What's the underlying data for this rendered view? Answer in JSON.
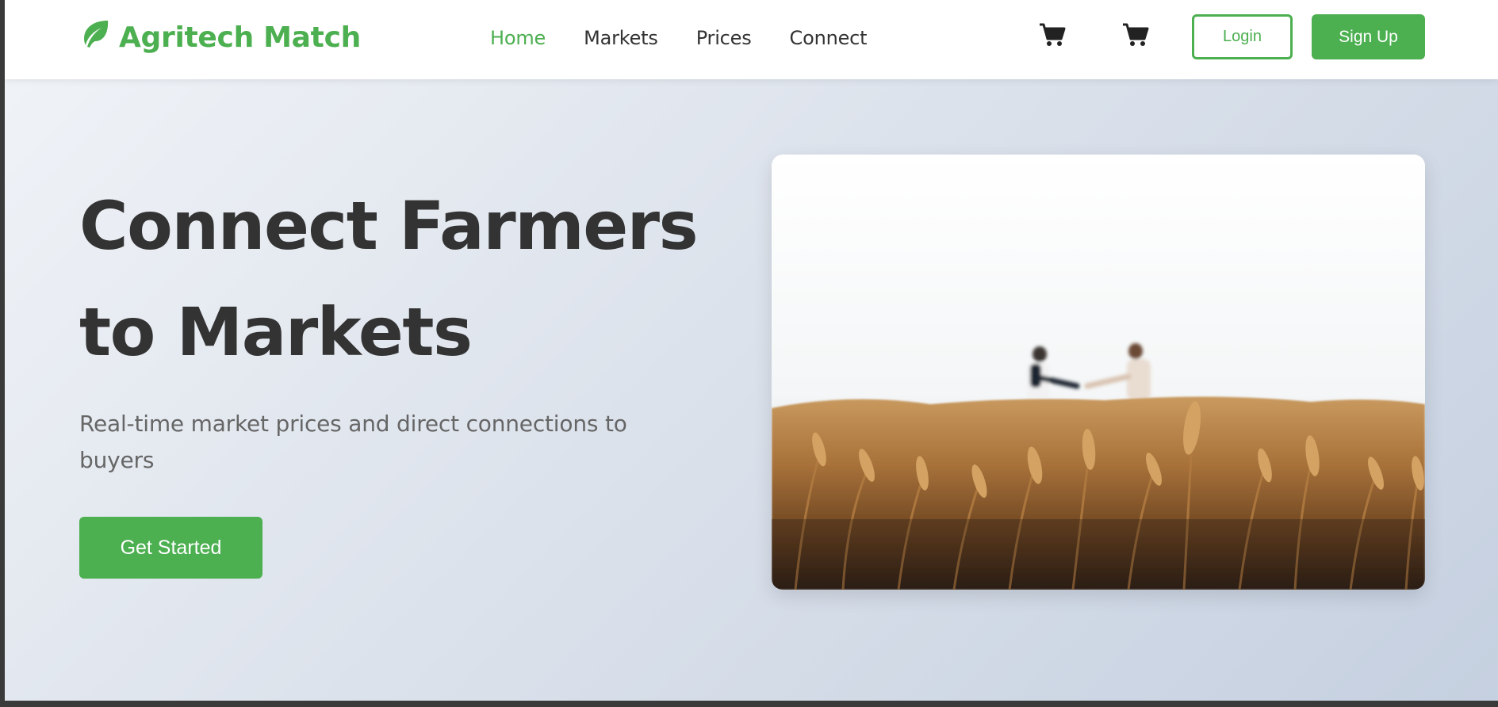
{
  "brand": {
    "name": "Agritech Match",
    "color": "#4caf50",
    "icon": "leaf-icon"
  },
  "nav": {
    "links": [
      {
        "label": "Home",
        "active": true
      },
      {
        "label": "Markets",
        "active": false
      },
      {
        "label": "Prices",
        "active": false
      },
      {
        "label": "Connect",
        "active": false
      }
    ],
    "cart_icons": [
      "cart-icon",
      "cart-icon"
    ],
    "login_label": "Login",
    "signup_label": "Sign Up"
  },
  "hero": {
    "title_line1": "Connect Farmers",
    "title_line2": "to Markets",
    "subtitle": "Real-time market prices and direct connections to buyers",
    "cta_label": "Get Started",
    "image_description": "wheat-field-handshake-photo"
  }
}
